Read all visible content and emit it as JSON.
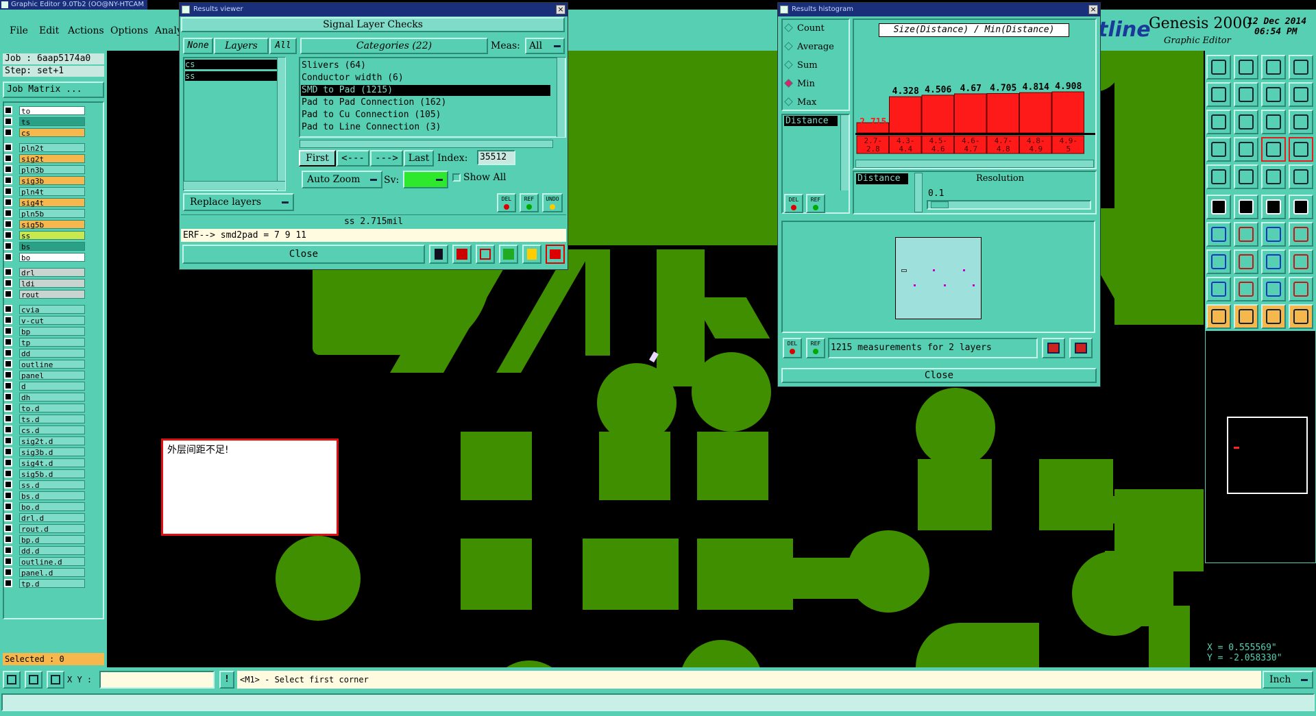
{
  "app": {
    "title": "Graphic Editor 9.0Tb2  (OO@NY-HTCAM",
    "menus": [
      "File",
      "Edit",
      "Actions",
      "Options",
      "Analy"
    ],
    "brand_fragment": "tline",
    "product_name": "Genesis 2000",
    "product_sub": "Graphic Editor",
    "date": "12 Dec 2014",
    "time": "06:54 PM"
  },
  "job": {
    "job_label": "Job : 6aap5174a0",
    "step_label": "Step: set+1",
    "matrix_button": "Job Matrix ..."
  },
  "layers": [
    {
      "name": "to",
      "color": "white",
      "group": 1
    },
    {
      "name": "ts",
      "color": "green",
      "group": 1
    },
    {
      "name": "cs",
      "color": "orange",
      "group": 1
    },
    {
      "name": "pln2t",
      "color": "teal",
      "group": 2
    },
    {
      "name": "sig2t",
      "color": "orange",
      "group": 2
    },
    {
      "name": "pln3b",
      "color": "teal",
      "group": 2
    },
    {
      "name": "sig3b",
      "color": "orange",
      "group": 2
    },
    {
      "name": "pln4t",
      "color": "teal",
      "group": 2
    },
    {
      "name": "sig4t",
      "color": "orange",
      "group": 2
    },
    {
      "name": "pln5b",
      "color": "teal",
      "group": 2
    },
    {
      "name": "sig5b",
      "color": "orange",
      "group": 2
    },
    {
      "name": "ss",
      "color": "yellowgreen",
      "group": 2
    },
    {
      "name": "bs",
      "color": "green",
      "group": 2
    },
    {
      "name": "bo",
      "color": "white",
      "group": 2
    },
    {
      "name": "drl",
      "color": "gray",
      "group": 3
    },
    {
      "name": "ldi",
      "color": "gray",
      "group": 3
    },
    {
      "name": "rout",
      "color": "gray",
      "group": 3
    },
    {
      "name": "cvia",
      "color": "teal",
      "group": 4
    },
    {
      "name": "v-cut",
      "color": "teal",
      "group": 4
    },
    {
      "name": "bp",
      "color": "teal",
      "group": 4
    },
    {
      "name": "tp",
      "color": "teal",
      "group": 4
    },
    {
      "name": "dd",
      "color": "teal",
      "group": 4
    },
    {
      "name": "outline",
      "color": "teal",
      "group": 4
    },
    {
      "name": "panel",
      "color": "teal",
      "group": 4
    },
    {
      "name": "d",
      "color": "teal",
      "group": 4
    },
    {
      "name": "dh",
      "color": "teal",
      "group": 4
    },
    {
      "name": "to.d",
      "color": "teal",
      "group": 4
    },
    {
      "name": "ts.d",
      "color": "teal",
      "group": 4
    },
    {
      "name": "cs.d",
      "color": "teal",
      "group": 4
    },
    {
      "name": "sig2t.d",
      "color": "teal",
      "group": 4
    },
    {
      "name": "sig3b.d",
      "color": "teal",
      "group": 4
    },
    {
      "name": "sig4t.d",
      "color": "teal",
      "group": 4
    },
    {
      "name": "sig5b.d",
      "color": "teal",
      "group": 4
    },
    {
      "name": "ss.d",
      "color": "teal",
      "group": 4
    },
    {
      "name": "bs.d",
      "color": "teal",
      "group": 4
    },
    {
      "name": "bo.d",
      "color": "teal",
      "group": 4
    },
    {
      "name": "drl.d",
      "color": "teal",
      "group": 4
    },
    {
      "name": "rout.d",
      "color": "teal",
      "group": 4
    },
    {
      "name": "bp.d",
      "color": "teal",
      "group": 4
    },
    {
      "name": "dd.d",
      "color": "teal",
      "group": 4
    },
    {
      "name": "outline.d",
      "color": "teal",
      "group": 4
    },
    {
      "name": "panel.d",
      "color": "teal",
      "group": 4
    },
    {
      "name": "tp.d",
      "color": "teal",
      "group": 4
    }
  ],
  "selected_label": "Selected : 0",
  "results_viewer": {
    "title": "Results viewer",
    "header": "Signal Layer Checks",
    "none_btn": "None",
    "layers_btn": "Layers",
    "all_btn": "All",
    "layer_list": [
      "cs",
      "ss"
    ],
    "categories_label": "Categories (22)",
    "meas_label": "Meas:",
    "meas_value": "All",
    "categories": [
      "Slivers (64)",
      "Conductor width (6)",
      "SMD to Pad (1215)",
      "Pad to Pad Connection (162)",
      "Pad to Cu Connection (105)",
      "Pad to Line Connection (3)"
    ],
    "selected_category": 2,
    "first_btn": "First",
    "prev_btn": "<---",
    "next_btn": "--->",
    "last_btn": "Last",
    "index_label": "Index:",
    "index_value": "35512",
    "zoom_label": "Auto Zoom",
    "sv_label": "Sv:",
    "show_all_label": "Show All",
    "replace_btn": "Replace layers",
    "del_btn": "DEL",
    "ref_btn": "REF",
    "undo_btn": "UNDO",
    "status": "ss 2.715mil",
    "erf_line": "ERF--> smd2pad = 7 9 11",
    "close_btn": "Close"
  },
  "histogram": {
    "title": "Results histogram",
    "options": [
      "Count",
      "Average",
      "Sum",
      "Min",
      "Max"
    ],
    "selected_option": "Min",
    "list_item": "Distance",
    "chart_title": "Size(Distance) / Min(Distance)",
    "bars": [
      {
        "range": "2.7- 2.8",
        "value": "2.715",
        "v": 2.715
      },
      {
        "range": "4.3- 4.4",
        "value": "4.328",
        "v": 4.328
      },
      {
        "range": "4.5- 4.6",
        "value": "4.506",
        "v": 4.506
      },
      {
        "range": "4.6- 4.7",
        "value": "4.67",
        "v": 4.67
      },
      {
        "range": "4.7- 4.8",
        "value": "4.705",
        "v": 4.705
      },
      {
        "range": "4.8- 4.9",
        "value": "4.814",
        "v": 4.814
      },
      {
        "range": "4.9- 5",
        "value": "4.908",
        "v": 4.908
      }
    ],
    "distance_label": "Distance",
    "resolution_label": "Resolution",
    "resolution_value": "0.1",
    "del_btn": "DEL",
    "ref_btn": "REF",
    "status": "1215 measurements for 2 layers",
    "close_btn": "Close"
  },
  "warning_text": "外层间距不足!",
  "coords": {
    "x": "X = 0.555569\"",
    "y": "Y = -2.058330\""
  },
  "bottom": {
    "xy_label": "X Y :",
    "xy_value": "",
    "prompt": "<M1> - Select first corner",
    "unit": "Inch"
  },
  "colors": {
    "teal": "#57cfb3",
    "copper": "#3f8f00",
    "histbar": "#ff1a1a",
    "titlebar": "#1a2f7a"
  }
}
